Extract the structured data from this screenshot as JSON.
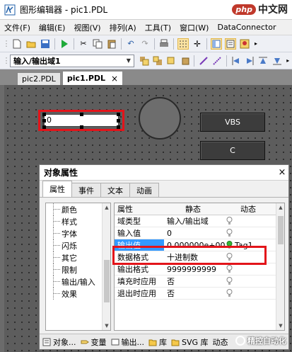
{
  "window": {
    "title": "图形编辑器 - pic1.PDL"
  },
  "watermark_top": {
    "badge": "php",
    "text": "中文网"
  },
  "menu": [
    "文件(F)",
    "编辑(E)",
    "视图(V)",
    "排列(A)",
    "工具(T)",
    "窗口(W)",
    "DataConnector"
  ],
  "toolbar2": {
    "combo_value": "输入/输出域1"
  },
  "doc_tabs": [
    {
      "label": "pic2.PDL",
      "active": false
    },
    {
      "label": "pic1.PDL",
      "active": true,
      "close": "×"
    }
  ],
  "canvas": {
    "io_field_value": "0",
    "buttons": [
      "VBS",
      "C"
    ]
  },
  "props": {
    "title": "对象属性",
    "close": "×",
    "tabs": [
      "属性",
      "事件",
      "文本",
      "动画"
    ],
    "tree": [
      "颜色",
      "样式",
      "字体",
      "闪烁",
      "其它",
      "限制",
      "输出/输入",
      "效果"
    ],
    "grid_headers": [
      "属性",
      "静态",
      "动态"
    ],
    "rows": [
      {
        "name": "域类型",
        "value": "输入/输出域",
        "dynamic": ""
      },
      {
        "name": "输入值",
        "value": "0",
        "dynamic": ""
      },
      {
        "name": "输出值",
        "value": "0.000000e+00",
        "dynamic": "Tag1"
      },
      {
        "name": "数据格式",
        "value": "十进制数",
        "dynamic": ""
      },
      {
        "name": "输出格式",
        "value": "9999999999",
        "dynamic": ""
      },
      {
        "name": "填充时应用",
        "value": "否",
        "dynamic": ""
      },
      {
        "name": "退出时应用",
        "value": "否",
        "dynamic": ""
      }
    ],
    "bottom_tabs": [
      "对象...",
      "变量",
      "输出...",
      "库",
      "SVG 库",
      "动态"
    ]
  },
  "watermark_bottom": {
    "text": "精控自动化"
  },
  "colors": {
    "highlight": "#e3141a",
    "selection": "#3399ff",
    "bulb_active": "#35b535"
  }
}
